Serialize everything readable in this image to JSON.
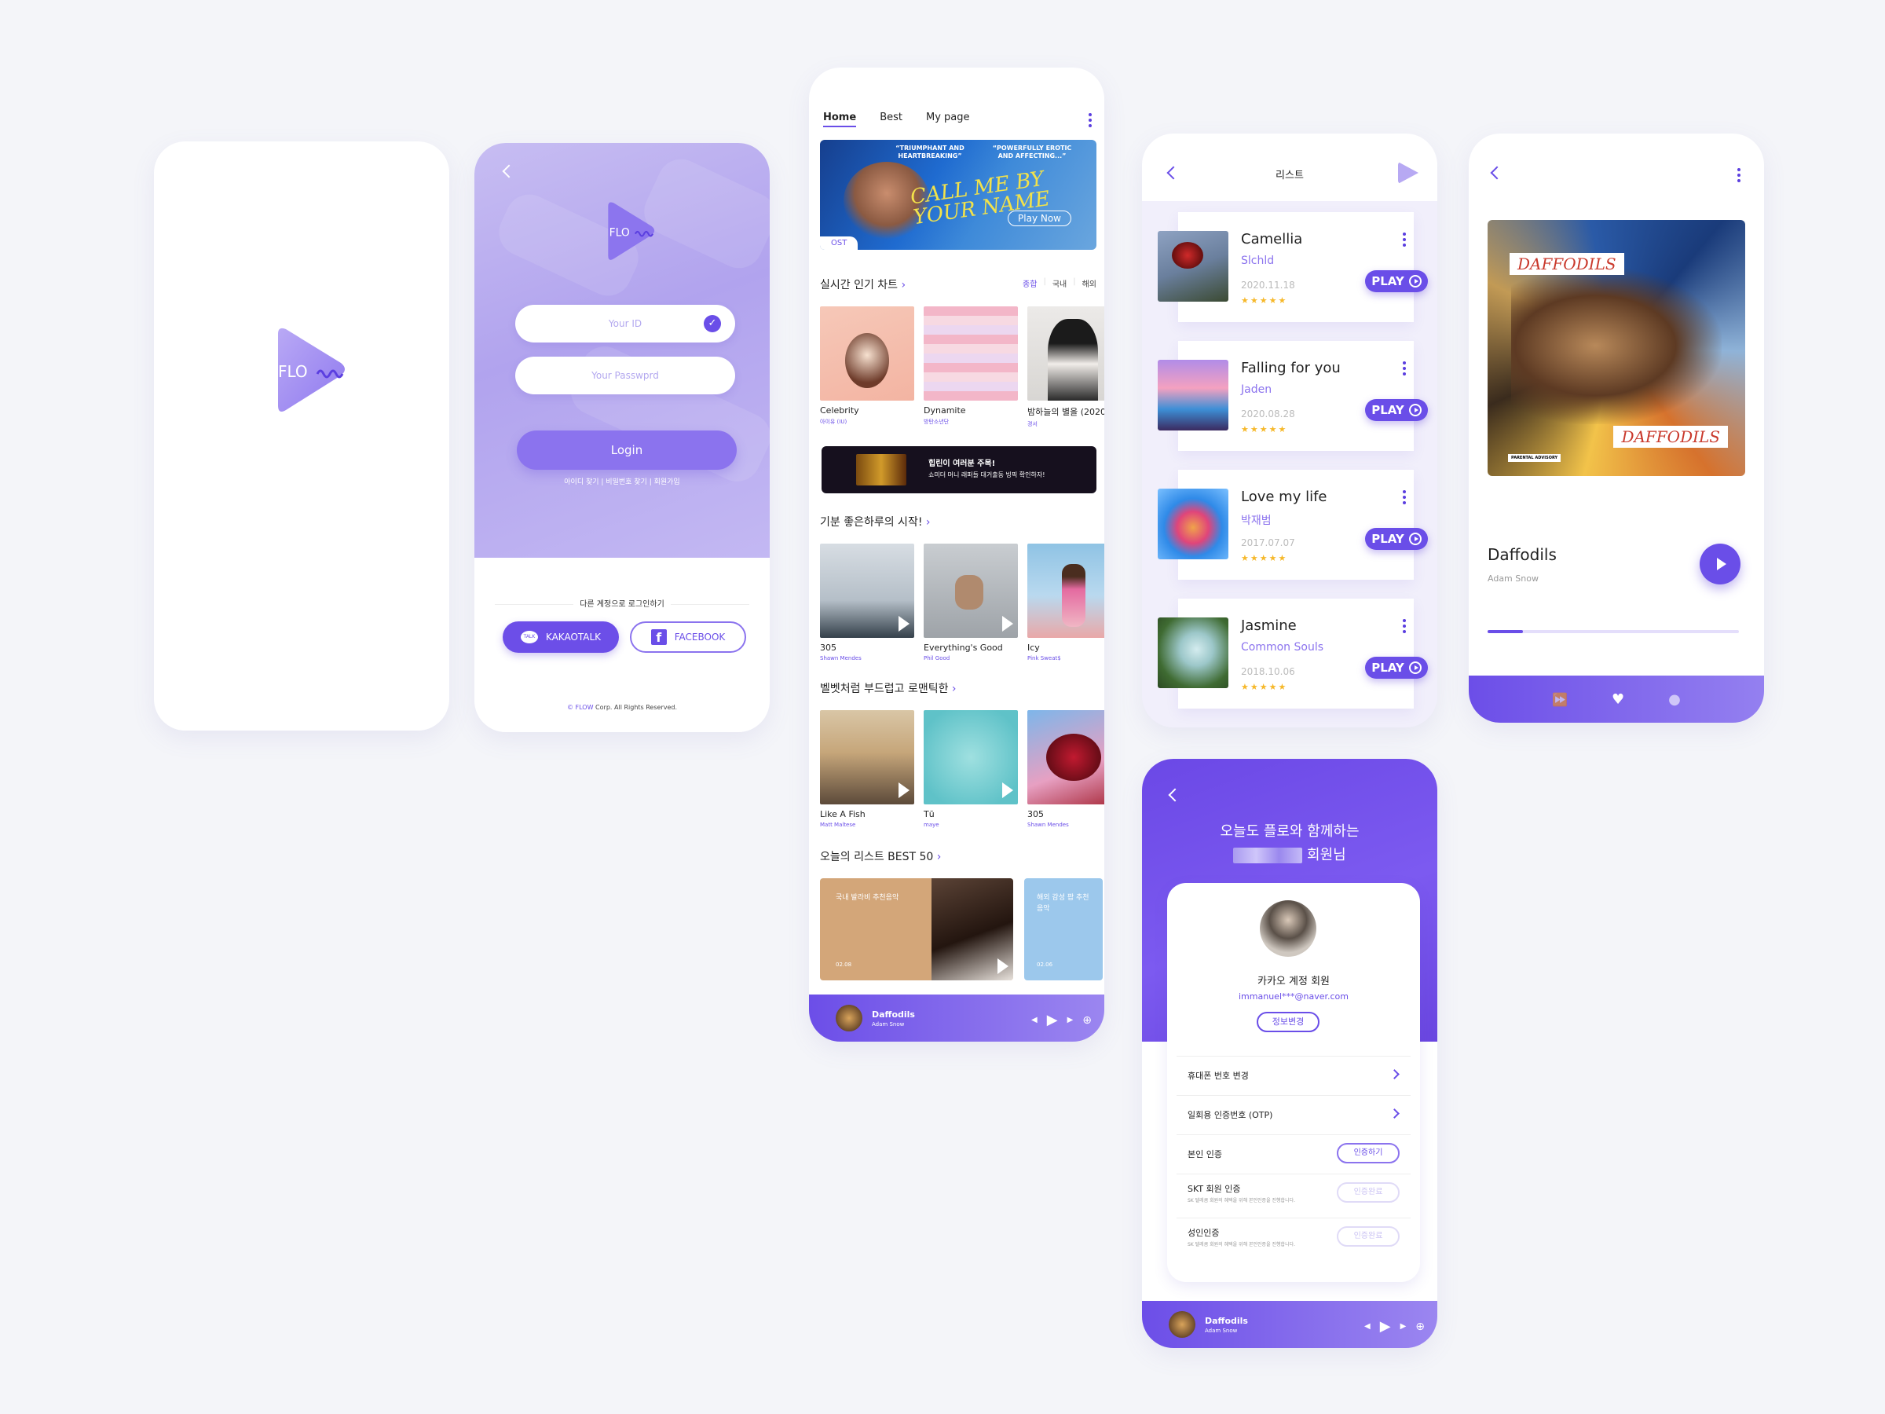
{
  "colors": {
    "accent": "#6a4ee8",
    "accent_light": "#b1a3ee",
    "star": "#f6b82a"
  },
  "logo": {
    "text": "FLO"
  },
  "login": {
    "id_placeholder": "Your ID",
    "password_placeholder": "Your Passwprd",
    "login_label": "Login",
    "links": "아이디 찾기  |  비밀번호 찾기  |  회원가입",
    "other_login": "다른 계정으로 로그인하기",
    "kakao_label": "KAKAOTALK",
    "kakao_icon_text": "TALK",
    "facebook_label": "FACEBOOK",
    "copyright_brand": "© FLOW",
    "copyright_rest": " Corp. All Rights Reserved."
  },
  "home": {
    "tabs": [
      "Home",
      "Best",
      "My page"
    ],
    "banner": {
      "quote_left": "“TRIUMPHANT AND HEARTBREAKING”",
      "quote_right": "“POWERFULLY EROTIC AND AFFECTING...”",
      "script": "CALL ME BY YOUR NAME",
      "play_now": "Play Now",
      "badge": "OST"
    },
    "section_chart": "실시간 인기 차트",
    "filters": [
      "종합",
      "국내",
      "해외"
    ],
    "chart": [
      {
        "title": "Celebrity",
        "artist": "아이유 (IU)"
      },
      {
        "title": "Dynamite",
        "artist": "방탄소년단"
      },
      {
        "title": "밤하늘의 별을 (2020",
        "artist": "경서"
      }
    ],
    "ad_text_1": "힙린이 여러분 주목!",
    "ad_text_2": "쇼미더 머니 래퍼들 대거출동 빙픽 확인하자!",
    "section_mood": "기분 좋은하루의 시작!",
    "mood": [
      {
        "title": "305",
        "artist": "Shawn Mendes"
      },
      {
        "title": "Everything's Good",
        "artist": "Phil Good"
      },
      {
        "title": "Icy",
        "artist": "Pink Sweat$"
      }
    ],
    "section_romance": "벨벳처럼 부드럽고 로맨틱한",
    "romance": [
      {
        "title": "Like A Fish",
        "artist": "Matt Maltese"
      },
      {
        "title": "Tū",
        "artist": "maye"
      },
      {
        "title": "305",
        "artist": "Shawn Mendes"
      }
    ],
    "section_best": "오늘의 리스트 BEST 50",
    "best": [
      {
        "label": "국내 발라비 추천음악",
        "date": "02.08"
      },
      {
        "label": "해외 감성 팝 추천음악",
        "date": "02.06"
      }
    ],
    "mini_player": {
      "title": "Daffodils",
      "artist": "Adam Snow"
    }
  },
  "list": {
    "title": "리스트",
    "play_label": "PLAY",
    "songs": [
      {
        "title": "Camellia",
        "artist": "Slchld",
        "date": "2020.11.18",
        "stars": "★★★★★"
      },
      {
        "title": "Falling for you",
        "artist": "Jaden",
        "date": "2020.08.28",
        "stars": "★★★★★"
      },
      {
        "title": "Love my life",
        "artist": "박재범",
        "date": "2017.07.07",
        "stars": "★★★★★"
      },
      {
        "title": "Jasmine",
        "artist": "Common Souls",
        "date": "2018.10.06",
        "stars": "★★★★★"
      }
    ]
  },
  "player": {
    "title": "Daffodils",
    "artist": "Adam Snow",
    "album_label": "DAFFODILS",
    "advisory": "PARENTAL ADVISORY",
    "progress": 0.14
  },
  "profile": {
    "greeting": "오늘도 플로와 함께하는",
    "greeting_suffix": "회원님",
    "name": "카카오 계정 회원",
    "email": "immanuel***@naver.com",
    "edit_label": "정보변경",
    "menu": [
      {
        "label": "휴대폰 번호 변경"
      },
      {
        "label": "일회용 인증번호 (OTP)"
      },
      {
        "label": "본인 인증",
        "button": "인증하기"
      },
      {
        "label": "SKT 회원 인증",
        "sub": "SK 텔레콤 회원의 혜택을 위해 본인인증을 진행합니다.",
        "button": "인증완료"
      },
      {
        "label": "성인인증",
        "sub": "SK 텔레콤 회원의 혜택을 위해 본인인증을 진행합니다.",
        "button": "인증완료"
      }
    ],
    "mini_player": {
      "title": "Daffodils",
      "artist": "Adam Snow"
    }
  }
}
